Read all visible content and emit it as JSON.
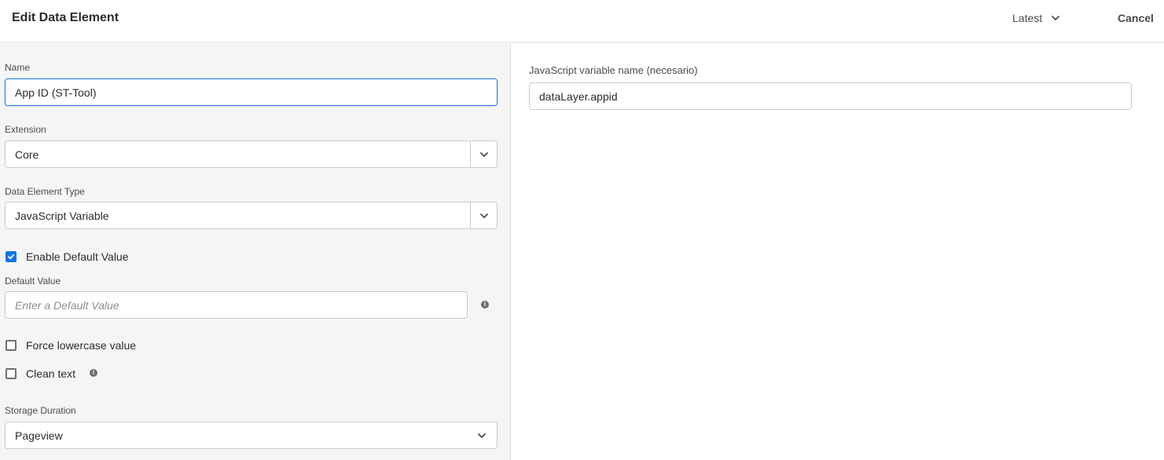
{
  "header": {
    "title": "Edit Data Element",
    "version_label": "Latest",
    "cancel_label": "Cancel"
  },
  "form": {
    "name_label": "Name",
    "name_value": "App ID (ST-Tool)",
    "extension_label": "Extension",
    "extension_value": "Core",
    "type_label": "Data Element Type",
    "type_value": "JavaScript Variable",
    "enable_default_label": "Enable Default Value",
    "enable_default_checked": true,
    "default_value_label": "Default Value",
    "default_value_placeholder": "Enter a Default Value",
    "force_lowercase_label": "Force lowercase value",
    "force_lowercase_checked": false,
    "clean_text_label": "Clean text",
    "clean_text_checked": false,
    "storage_duration_label": "Storage Duration",
    "storage_duration_value": "Pageview"
  },
  "config": {
    "js_var_label": "JavaScript variable name (necesario)",
    "js_var_value": "dataLayer.appid"
  },
  "icons": {
    "chevron": "chevron-down-icon",
    "info": "info-icon",
    "check": "checkmark-icon"
  },
  "colors": {
    "accent": "#1473e6",
    "focus": "#2680eb"
  }
}
